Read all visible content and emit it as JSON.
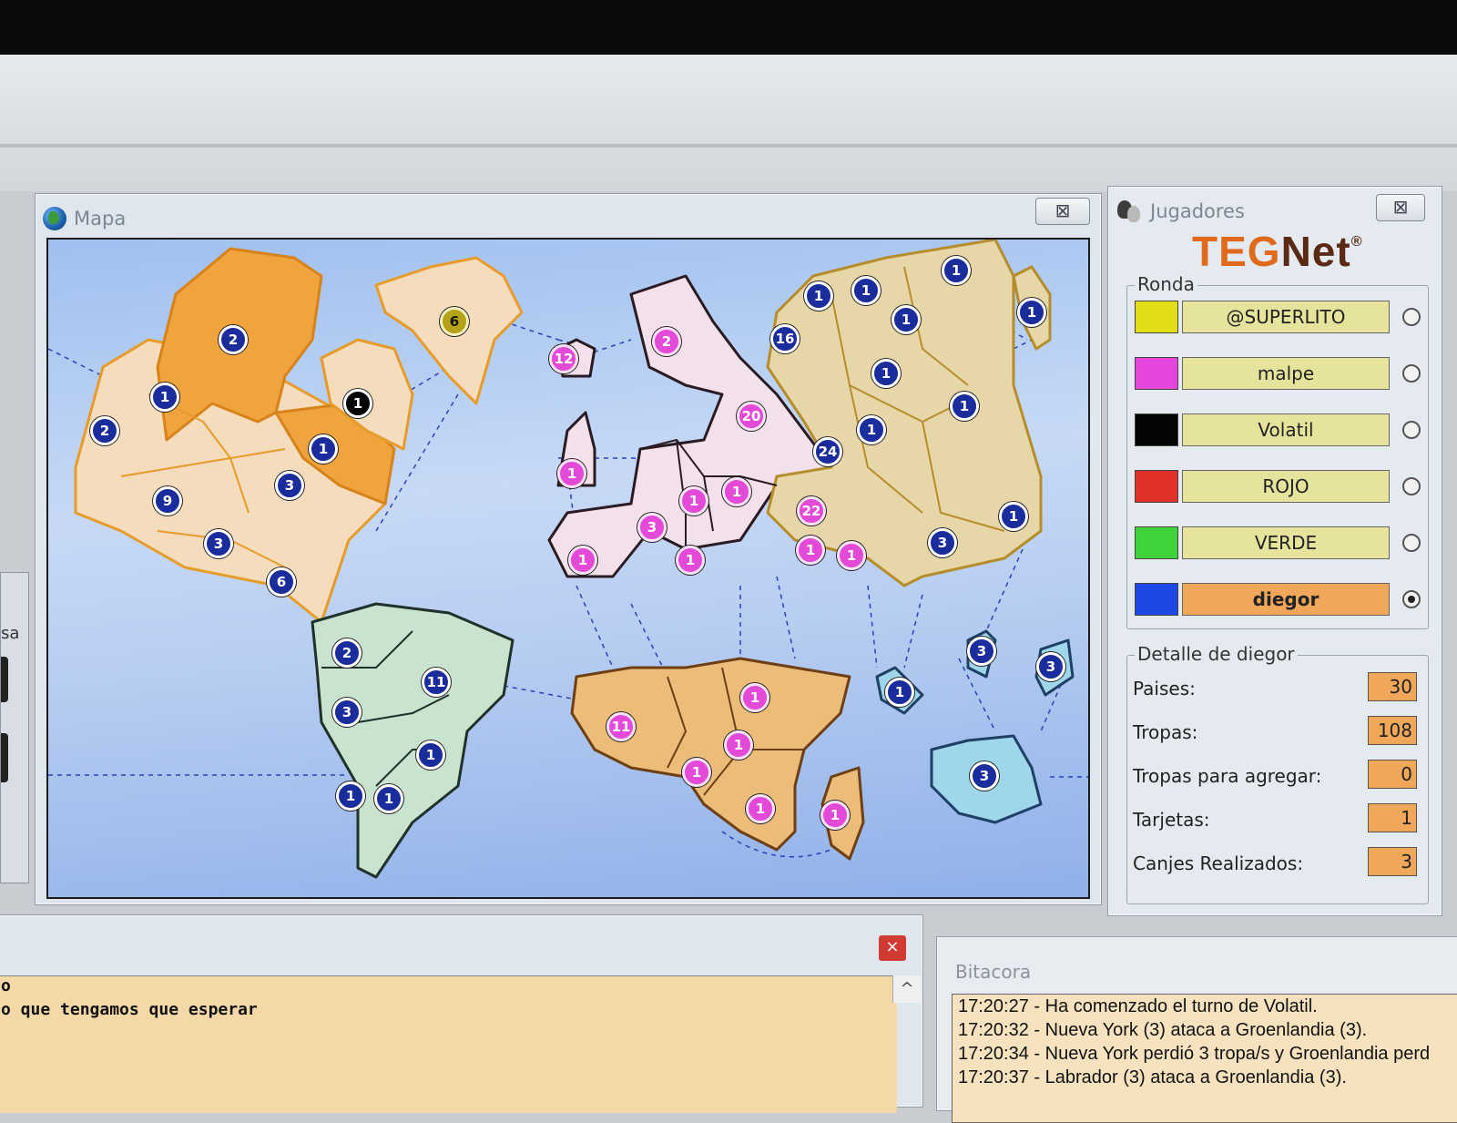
{
  "map_window": {
    "title": "Mapa",
    "close": "⊠"
  },
  "left_stub": {
    "text": "sa"
  },
  "pins": [
    {
      "value": "2",
      "color": "blue"
    },
    {
      "value": "1",
      "color": "blue"
    },
    {
      "value": "2",
      "color": "blue"
    },
    {
      "value": "9",
      "color": "blue"
    },
    {
      "value": "3",
      "color": "blue"
    },
    {
      "value": "1",
      "color": "blue"
    },
    {
      "value": "3",
      "color": "blue"
    },
    {
      "value": "6",
      "color": "blue"
    },
    {
      "value": "6",
      "color": "olive"
    },
    {
      "value": "1",
      "color": "black"
    },
    {
      "value": "2",
      "color": "blue"
    },
    {
      "value": "11",
      "color": "blue"
    },
    {
      "value": "3",
      "color": "blue"
    },
    {
      "value": "1",
      "color": "blue"
    },
    {
      "value": "1",
      "color": "blue"
    },
    {
      "value": "1",
      "color": "blue"
    },
    {
      "value": "12",
      "color": "magenta"
    },
    {
      "value": "2",
      "color": "magenta"
    },
    {
      "value": "20",
      "color": "magenta"
    },
    {
      "value": "1",
      "color": "magenta"
    },
    {
      "value": "1",
      "color": "magenta"
    },
    {
      "value": "3",
      "color": "magenta"
    },
    {
      "value": "1",
      "color": "magenta"
    },
    {
      "value": "1",
      "color": "magenta"
    },
    {
      "value": "1",
      "color": "magenta"
    },
    {
      "value": "22",
      "color": "magenta"
    },
    {
      "value": "1",
      "color": "magenta"
    },
    {
      "value": "1",
      "color": "magenta"
    },
    {
      "value": "11",
      "color": "magenta"
    },
    {
      "value": "1",
      "color": "magenta"
    },
    {
      "value": "1",
      "color": "magenta"
    },
    {
      "value": "1",
      "color": "magenta"
    },
    {
      "value": "1",
      "color": "magenta"
    },
    {
      "value": "1",
      "color": "magenta"
    },
    {
      "value": "1",
      "color": "blue"
    },
    {
      "value": "1",
      "color": "blue"
    },
    {
      "value": "1",
      "color": "blue"
    },
    {
      "value": "1",
      "color": "blue"
    },
    {
      "value": "1",
      "color": "blue"
    },
    {
      "value": "16",
      "color": "blue"
    },
    {
      "value": "1",
      "color": "blue"
    },
    {
      "value": "1",
      "color": "blue"
    },
    {
      "value": "1",
      "color": "blue"
    },
    {
      "value": "24",
      "color": "blue"
    },
    {
      "value": "1",
      "color": "blue"
    },
    {
      "value": "3",
      "color": "blue"
    },
    {
      "value": "3",
      "color": "blue"
    },
    {
      "value": "1",
      "color": "blue"
    },
    {
      "value": "3",
      "color": "blue"
    },
    {
      "value": "3",
      "color": "blue"
    }
  ],
  "players_window": {
    "title": "Jugadores",
    "close": "⊠",
    "logo": {
      "part1": "TEG",
      "part2": "Net",
      "mark": "®"
    },
    "ronda_label": "Ronda",
    "players": [
      {
        "name": "@SUPERLITO",
        "color": "#e3dc18",
        "selected": false
      },
      {
        "name": "malpe",
        "color": "#e645dc",
        "selected": false
      },
      {
        "name": "Volatil",
        "color": "#050505",
        "selected": false
      },
      {
        "name": "ROJO",
        "color": "#e2312b",
        "selected": false
      },
      {
        "name": "VERDE",
        "color": "#3fd23a",
        "selected": false
      },
      {
        "name": "diegor",
        "color": "#1e47e6",
        "selected": true
      }
    ],
    "detalle_label": "Detalle de diegor",
    "details": [
      {
        "label": "Paises:",
        "value": "30"
      },
      {
        "label": "Tropas:",
        "value": "108"
      },
      {
        "label": "Tropas para agregar:",
        "value": "0"
      },
      {
        "label": "Tarjetas:",
        "value": "1"
      },
      {
        "label": "Canjes Realizados:",
        "value": "3"
      }
    ]
  },
  "chat": {
    "close": "×",
    "lines": [
      "o",
      "o que tengamos que esperar"
    ],
    "scroll_up": "^"
  },
  "log": {
    "title": "Bitacora",
    "lines": [
      "17:20:27 - Ha comenzado el turno de Volatil.",
      "17:20:32 - Nueva York (3) ataca a Groenlandia (3).",
      "17:20:34 - Nueva York perdió 3 tropa/s y Groenlandia perd",
      "17:20:37 - Labrador (3) ataca a Groenlandia (3)."
    ]
  }
}
